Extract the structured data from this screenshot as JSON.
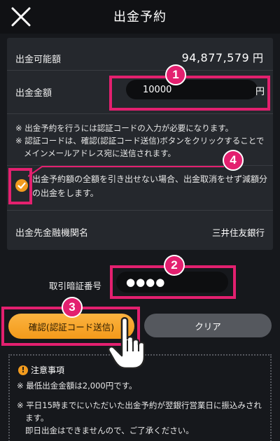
{
  "header": {
    "title": "出金予約"
  },
  "panel": {
    "available_label": "出金可能額",
    "available_value": "94,877,579",
    "available_unit": "円",
    "amount_label": "出金金額",
    "amount_value": "10000",
    "amount_unit": "円",
    "notes": [
      "※ 出金予約を行うには認証コードの入力が必要になります。",
      "※ 認証コードは、確認(認証コード送信)ボタンをクリックすることでメインメールアドレス宛に送信されます。"
    ],
    "agree_text": "出金予約額の全額を引き出せない場合、出金取消をせず減額分の出金をします。",
    "bank_label": "出金先金融機関名",
    "bank_value": "三井住友銀行"
  },
  "pin": {
    "label": "取引暗証番号",
    "value": "●●●●"
  },
  "buttons": {
    "confirm": "確認(認証コード送信)",
    "clear": "クリア"
  },
  "caution": {
    "title": "注意事項",
    "icon_glyph": "!",
    "items": [
      "※ 最低出金金額は2,000円です。",
      "※ 平日15時までにいただいた出金予約が翌銀行営業日に振込みされます。",
      "即日出金はできませんので、ご了承ください。"
    ]
  },
  "steps": [
    "1",
    "2",
    "3",
    "4"
  ],
  "colors": {
    "accent": "#f29b1e",
    "highlight": "#e3206f",
    "background": "#16181c",
    "panel": "#25282d"
  }
}
